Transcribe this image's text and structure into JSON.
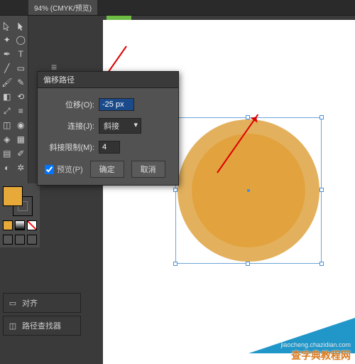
{
  "tabbar": {
    "doc_label": "94% (CMYK/预览)"
  },
  "dialog": {
    "title": "偏移路径",
    "offset_label": "位移(O):",
    "offset_value": "-25 px",
    "join_label": "连接(J):",
    "join_value": "斜接",
    "miter_label": "斜接限制(M):",
    "miter_value": "4",
    "preview_label": "预览(P)",
    "ok_label": "确定",
    "cancel_label": "取消"
  },
  "panels": {
    "align": "对齐",
    "pathfinder": "路径查找器"
  },
  "colors": {
    "fill": "#e6a93a",
    "outer": "#e3b15d",
    "inner": "#e2a33f"
  },
  "badge": {
    "main": "查字典教程网",
    "sub": "jiaocheng.chazidian.com"
  }
}
